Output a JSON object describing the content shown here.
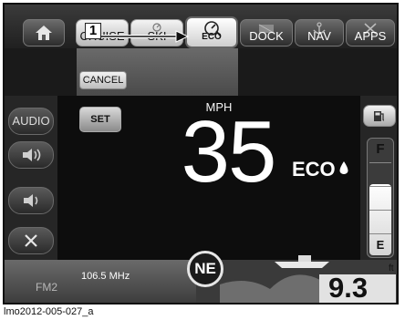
{
  "tabs": {
    "home": {
      "icon": "home-icon"
    },
    "cruise": {
      "label": "CRUISE"
    },
    "ski": {
      "label": "SKI"
    },
    "eco": {
      "label": "ECO",
      "icon": "eco-gauge-icon"
    },
    "dock": {
      "label": "DOCK",
      "icon": "dock-icon"
    },
    "nav": {
      "label": "NAV",
      "icon": "anchor-icon"
    },
    "apps": {
      "label": "APPS",
      "icon": "tools-icon"
    }
  },
  "callout": {
    "number": "1"
  },
  "menu": {
    "cancel_label": "CANCEL"
  },
  "sidebar": {
    "audio_label": "AUDIO",
    "volume_up_icon": "speaker-up-icon",
    "volume_down_icon": "speaker-down-icon",
    "mute_icon": "mute-icon"
  },
  "cruise_control": {
    "set_label": "SET"
  },
  "speed": {
    "unit": "MPH",
    "value": "35",
    "mode": "ECO"
  },
  "fuel": {
    "full_label": "F",
    "empty_label": "E",
    "level_fraction": 0.6,
    "icon": "fuel-pump-icon"
  },
  "radio": {
    "band": "FM2",
    "frequency": "106.5 MHz"
  },
  "compass": {
    "heading": "NE"
  },
  "depth": {
    "value": "9.3",
    "unit": "ft"
  },
  "caption": "lmo2012-005-027_a",
  "colors": {
    "background": "#1a1a1a",
    "tab_light": "#d9d9d9",
    "tab_dark": "#3d3d3d",
    "text": "#ffffff"
  }
}
